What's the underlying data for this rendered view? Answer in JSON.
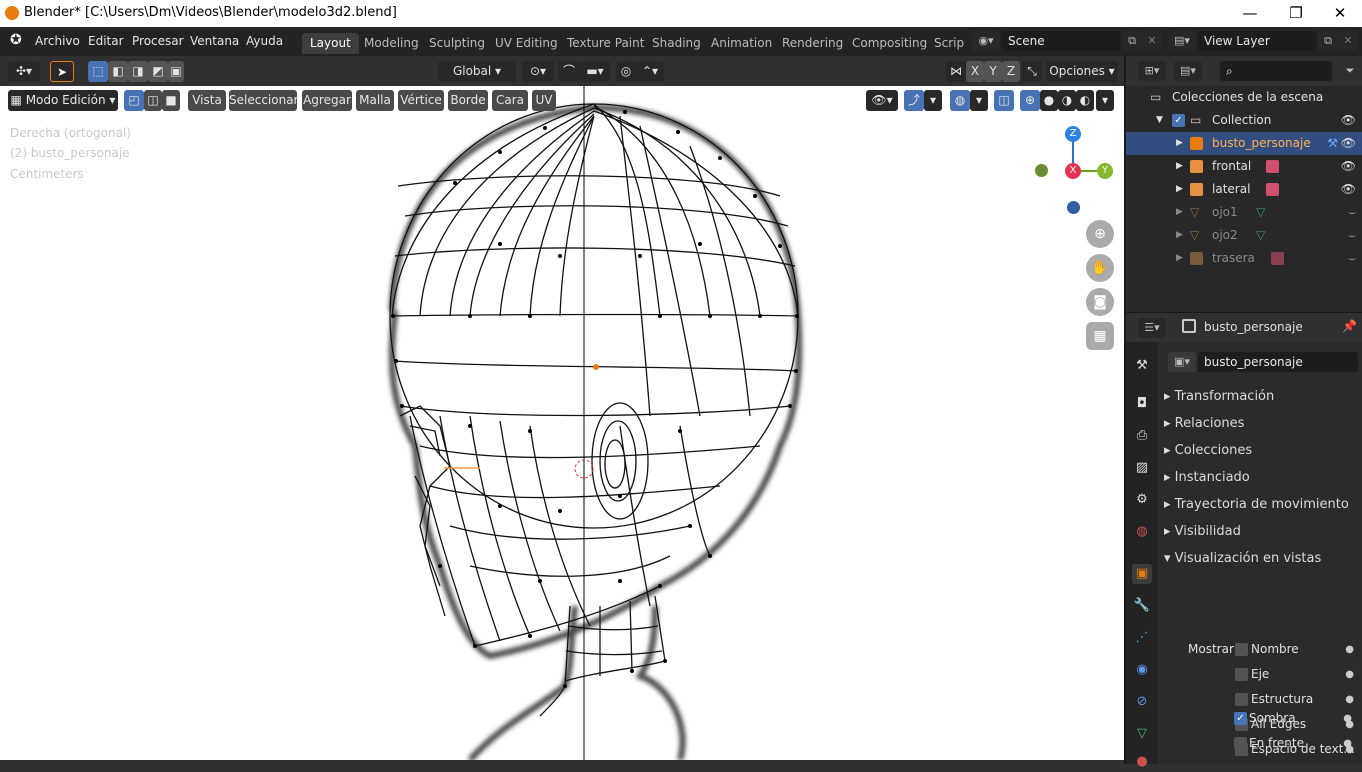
{
  "window": {
    "title": "Blender* [C:\\Users\\Dm\\Videos\\Blender\\modelo3d2.blend]",
    "minimize": "—",
    "maximize": "❐",
    "close": "✕"
  },
  "menu": [
    "Archivo",
    "Editar",
    "Procesar",
    "Ventana",
    "Ayuda"
  ],
  "workspaces": [
    "Layout",
    "Modeling",
    "Sculpting",
    "UV Editing",
    "Texture Paint",
    "Shading",
    "Animation",
    "Rendering",
    "Compositing",
    "Script"
  ],
  "scene": {
    "label": "Scene",
    "view_layer": "View Layer"
  },
  "viewport_header": {
    "transform": "Global",
    "options": "Opciones",
    "x": "X",
    "y": "Y",
    "z": "Z"
  },
  "edit_header": {
    "mode": "Modo Edición",
    "buttons": [
      "Vista",
      "Seleccionar",
      "Agregar",
      "Malla",
      "Vértice",
      "Borde",
      "Cara",
      "UV"
    ]
  },
  "overlay_text": {
    "view": "Derecha (ortogonal)",
    "object": "(2) busto_personaje",
    "units": "Centimeters"
  },
  "gizmo": {
    "z": "Z",
    "y": "Y",
    "x": "X"
  },
  "outliner": {
    "root": "Colecciones de la escena",
    "collection": "Collection",
    "items": [
      {
        "name": "busto_personaje",
        "type": "mesh",
        "selected": true,
        "visible": true
      },
      {
        "name": "frontal",
        "type": "image",
        "selected": false,
        "visible": true
      },
      {
        "name": "lateral",
        "type": "image",
        "selected": false,
        "visible": true
      },
      {
        "name": "ojo1",
        "type": "mesh",
        "selected": false,
        "visible": false
      },
      {
        "name": "ojo2",
        "type": "mesh",
        "selected": false,
        "visible": false
      },
      {
        "name": "trasera",
        "type": "image",
        "selected": false,
        "visible": false
      }
    ]
  },
  "properties": {
    "object_name": "busto_personaje",
    "field_name": "busto_personaje",
    "sections": [
      "Transformación",
      "Relaciones",
      "Colecciones",
      "Instanciado",
      "Trayectoria de movimiento",
      "Visibilidad",
      "Visualización en vistas"
    ],
    "mostrar_label": "Mostrar",
    "checkboxes": [
      {
        "label": "Nombre",
        "checked": false
      },
      {
        "label": "Eje",
        "checked": false
      },
      {
        "label": "Estructura",
        "checked": false
      },
      {
        "label": "All Edges",
        "checked": false
      },
      {
        "label": "Espacio de text...",
        "checked": false
      },
      {
        "label": "Sombra",
        "checked": true
      },
      {
        "label": "En frente",
        "checked": false
      }
    ]
  },
  "colors": {
    "accent": "#4772b3",
    "selected_row": "#334d80",
    "orange": "#e87d0d"
  }
}
